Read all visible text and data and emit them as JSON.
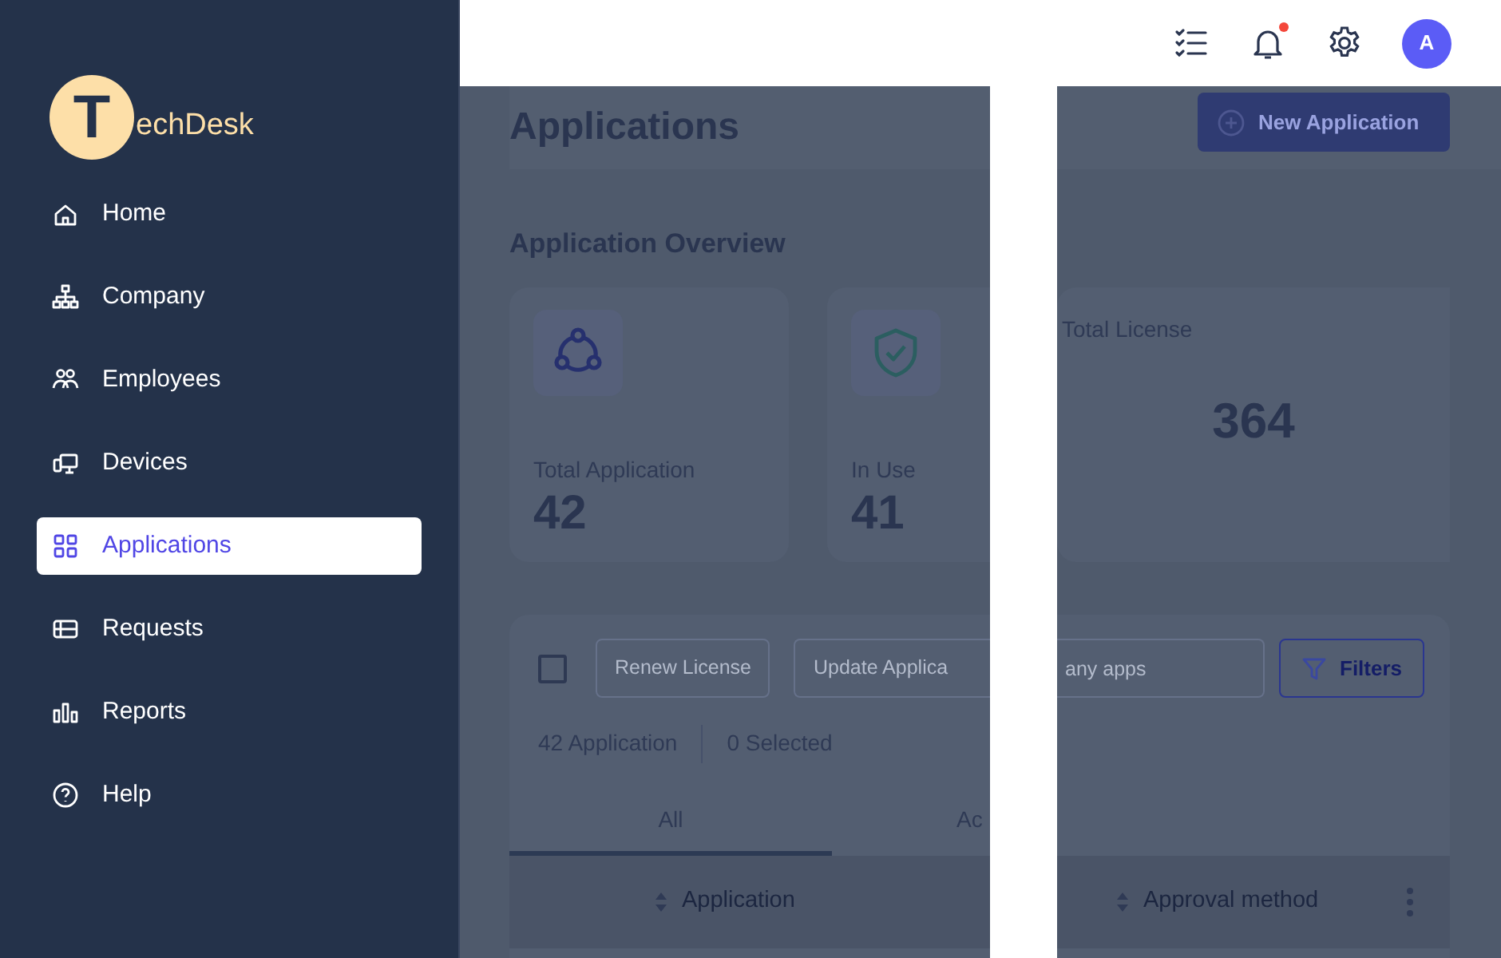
{
  "logo": {
    "letter": "T",
    "text": "echDesk"
  },
  "sidebar": {
    "items": [
      {
        "label": "Home",
        "selected": false
      },
      {
        "label": "Company",
        "selected": false
      },
      {
        "label": "Employees",
        "selected": false
      },
      {
        "label": "Devices",
        "selected": false
      },
      {
        "label": "Applications",
        "selected": true
      },
      {
        "label": "Requests",
        "selected": false
      },
      {
        "label": "Reports",
        "selected": false
      },
      {
        "label": "Help",
        "selected": false
      }
    ]
  },
  "topbar": {
    "notification_unread": true,
    "avatar": "A"
  },
  "page": {
    "title": "Applications",
    "new_button": "New Application"
  },
  "overview": {
    "title": "Application Overview",
    "cards": [
      {
        "kind": "stat",
        "label": "Total Application",
        "value": "42"
      },
      {
        "kind": "stat",
        "label": "In Use",
        "value": "41"
      },
      {
        "kind": "total",
        "label": "Total License",
        "value": "364"
      }
    ]
  },
  "table": {
    "select_all_checked": false,
    "renew_button": "Renew License",
    "update_button": "Update Applica",
    "search_placeholder": "any apps",
    "filters_button": "Filters",
    "count": "42 Application",
    "selected_count": "0 Selected",
    "tabs": [
      {
        "label": "All",
        "selected": true
      },
      {
        "label": "Ac",
        "selected": false
      }
    ],
    "columns": [
      "Application",
      "Approval method"
    ]
  }
}
